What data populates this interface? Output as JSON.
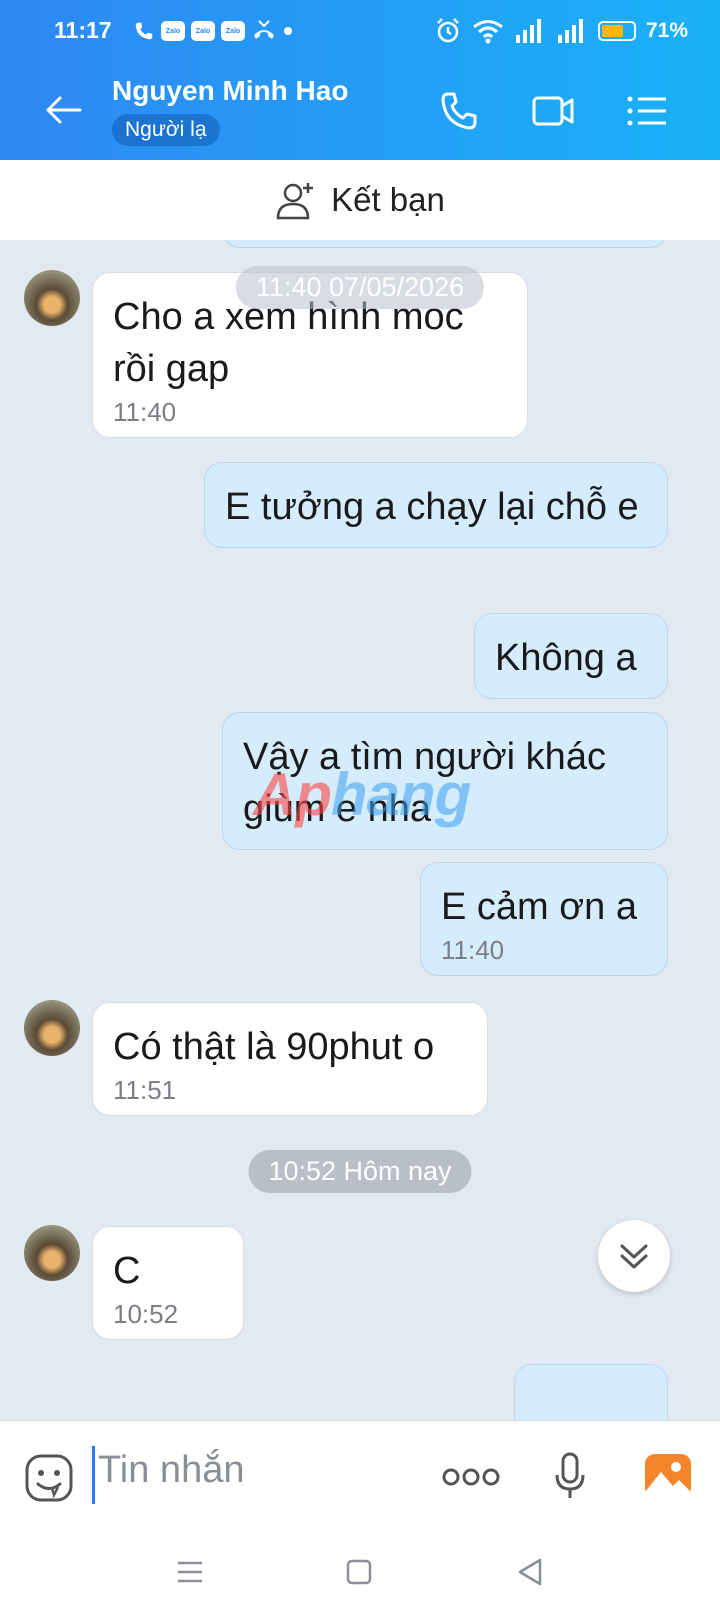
{
  "status": {
    "time": "11:17",
    "zalo_label": "Zalo",
    "battery": "71%",
    "battery_level": 0.71
  },
  "header": {
    "name": "Nguyen Minh Hao",
    "badge": "Người lạ"
  },
  "friend_bar": {
    "label": "Kết bạn"
  },
  "chat": {
    "date_chip_1": "11:40 07/05/2026",
    "date_chip_2": "10:52 Hôm nay",
    "messages": [
      {
        "text": "Cho a xem hình moc rồi gap",
        "time": "11:40"
      },
      {
        "text": "E tưởng a chạy lại chỗ e"
      },
      {
        "text": "Không a"
      },
      {
        "text": "Vậy a tìm người khác giùm e nha"
      },
      {
        "text": "E cảm ơn a",
        "time": "11:40"
      },
      {
        "text": "Có thật là 90phut o",
        "time": "11:51"
      },
      {
        "text": "C",
        "time": "10:52"
      }
    ],
    "watermark": "Aphang"
  },
  "input": {
    "placeholder": "Tin nhắn"
  },
  "colors": {
    "header_start": "#2e88f2",
    "header_end": "#1ab2f8",
    "outgoing": "#d5ecfd",
    "incoming": "#ffffff",
    "background": "#e2e9f1"
  }
}
